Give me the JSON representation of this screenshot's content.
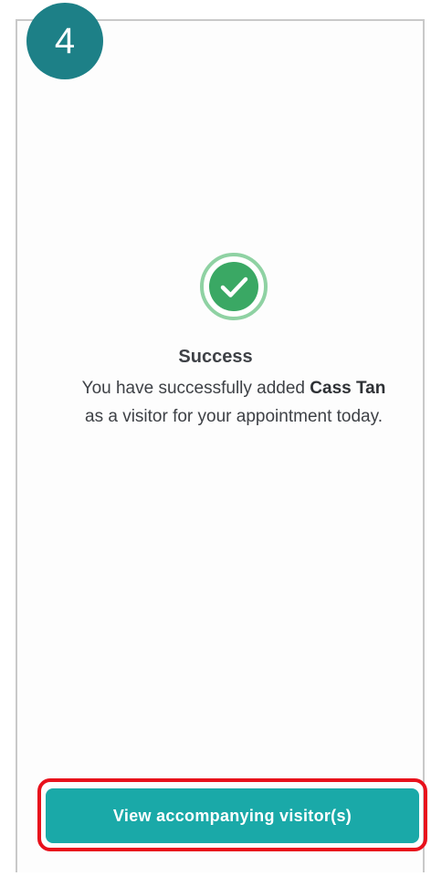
{
  "step": {
    "number": "4",
    "color": "#1d8087"
  },
  "icon": {
    "name": "check-circle-icon",
    "color": "#3aa864"
  },
  "success": {
    "title": "Success",
    "message_prefix": "You have successfully added",
    "visitor_name": "Cass Tan",
    "message_suffix": "as a visitor for your appointment today."
  },
  "actions": {
    "view_visitors_label": "View accompanying visitor(s)",
    "button_color": "#1aa9a8",
    "highlight_color": "#e8111c"
  }
}
